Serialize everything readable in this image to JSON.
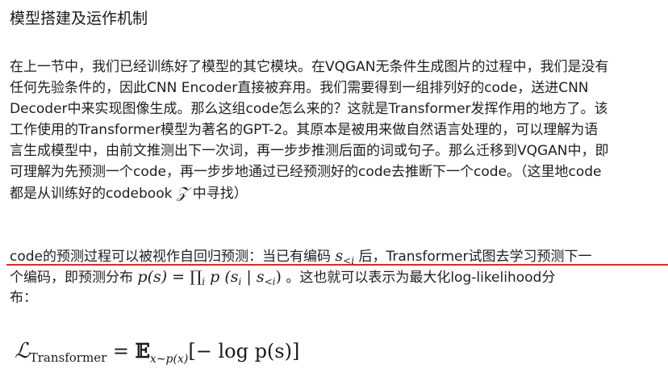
{
  "section": {
    "title": "模型搭建及运作机制"
  },
  "paragraph1": {
    "lines": [
      "在上一节中，我们已经训练好了模型的其它模块。在VQGAN无条件生成图片的过程中，我们是没有",
      "任何先验条件的，因此CNN Encoder直接被弃用。我们需要得到一组排列好的code，送进CNN",
      "Decoder中来实现图像生成。那么这组code怎么来的？这就是Transformer发挥作用的地方了。该",
      "工作使用的Transformer模型为著名的GPT-2。其原本是被用来做自然语言处理的，可以理解为语",
      "言生成模型中，由前文推测出下一次词，再一步步推测后面的词或句子。那么迁移到VQGAN中，即",
      "可理解为先预测一个code，再一步步地通过已经预测好的code去推断下一个code。（这里地code",
      "都是从训练好的codebook"
    ],
    "codebook_symbol": "𝒵",
    "line7_tail": " 中寻找）"
  },
  "paragraph2": {
    "line1_prefix": "code的预测过程可以被视作自回归预测：当已有编码 ",
    "s_var": "s",
    "s_sub": "<i",
    "line1_suffix": " 后，Transformer试图去学习预测下一",
    "line2_prefix": "个编码，即预测分布 ",
    "ps_formula": "p(s) = ∏",
    "prod_sub": "i",
    "ps_tail": " p (s",
    "si_sub": "i",
    "cond": " | s",
    "cond_sub": "<i",
    "close": ")",
    "line2_suffix": " 。这也就可以表示为最大化log-likelihood分",
    "line3": "布："
  },
  "formula": {
    "lhs": "ℒ",
    "lhs_sub": "Transformer",
    "eq": " = ",
    "expect": "𝔼",
    "expect_sub": "x∼p(x)",
    "body": "[− log p(s)]"
  },
  "highlight": {
    "underline_color": "#d42a32"
  }
}
